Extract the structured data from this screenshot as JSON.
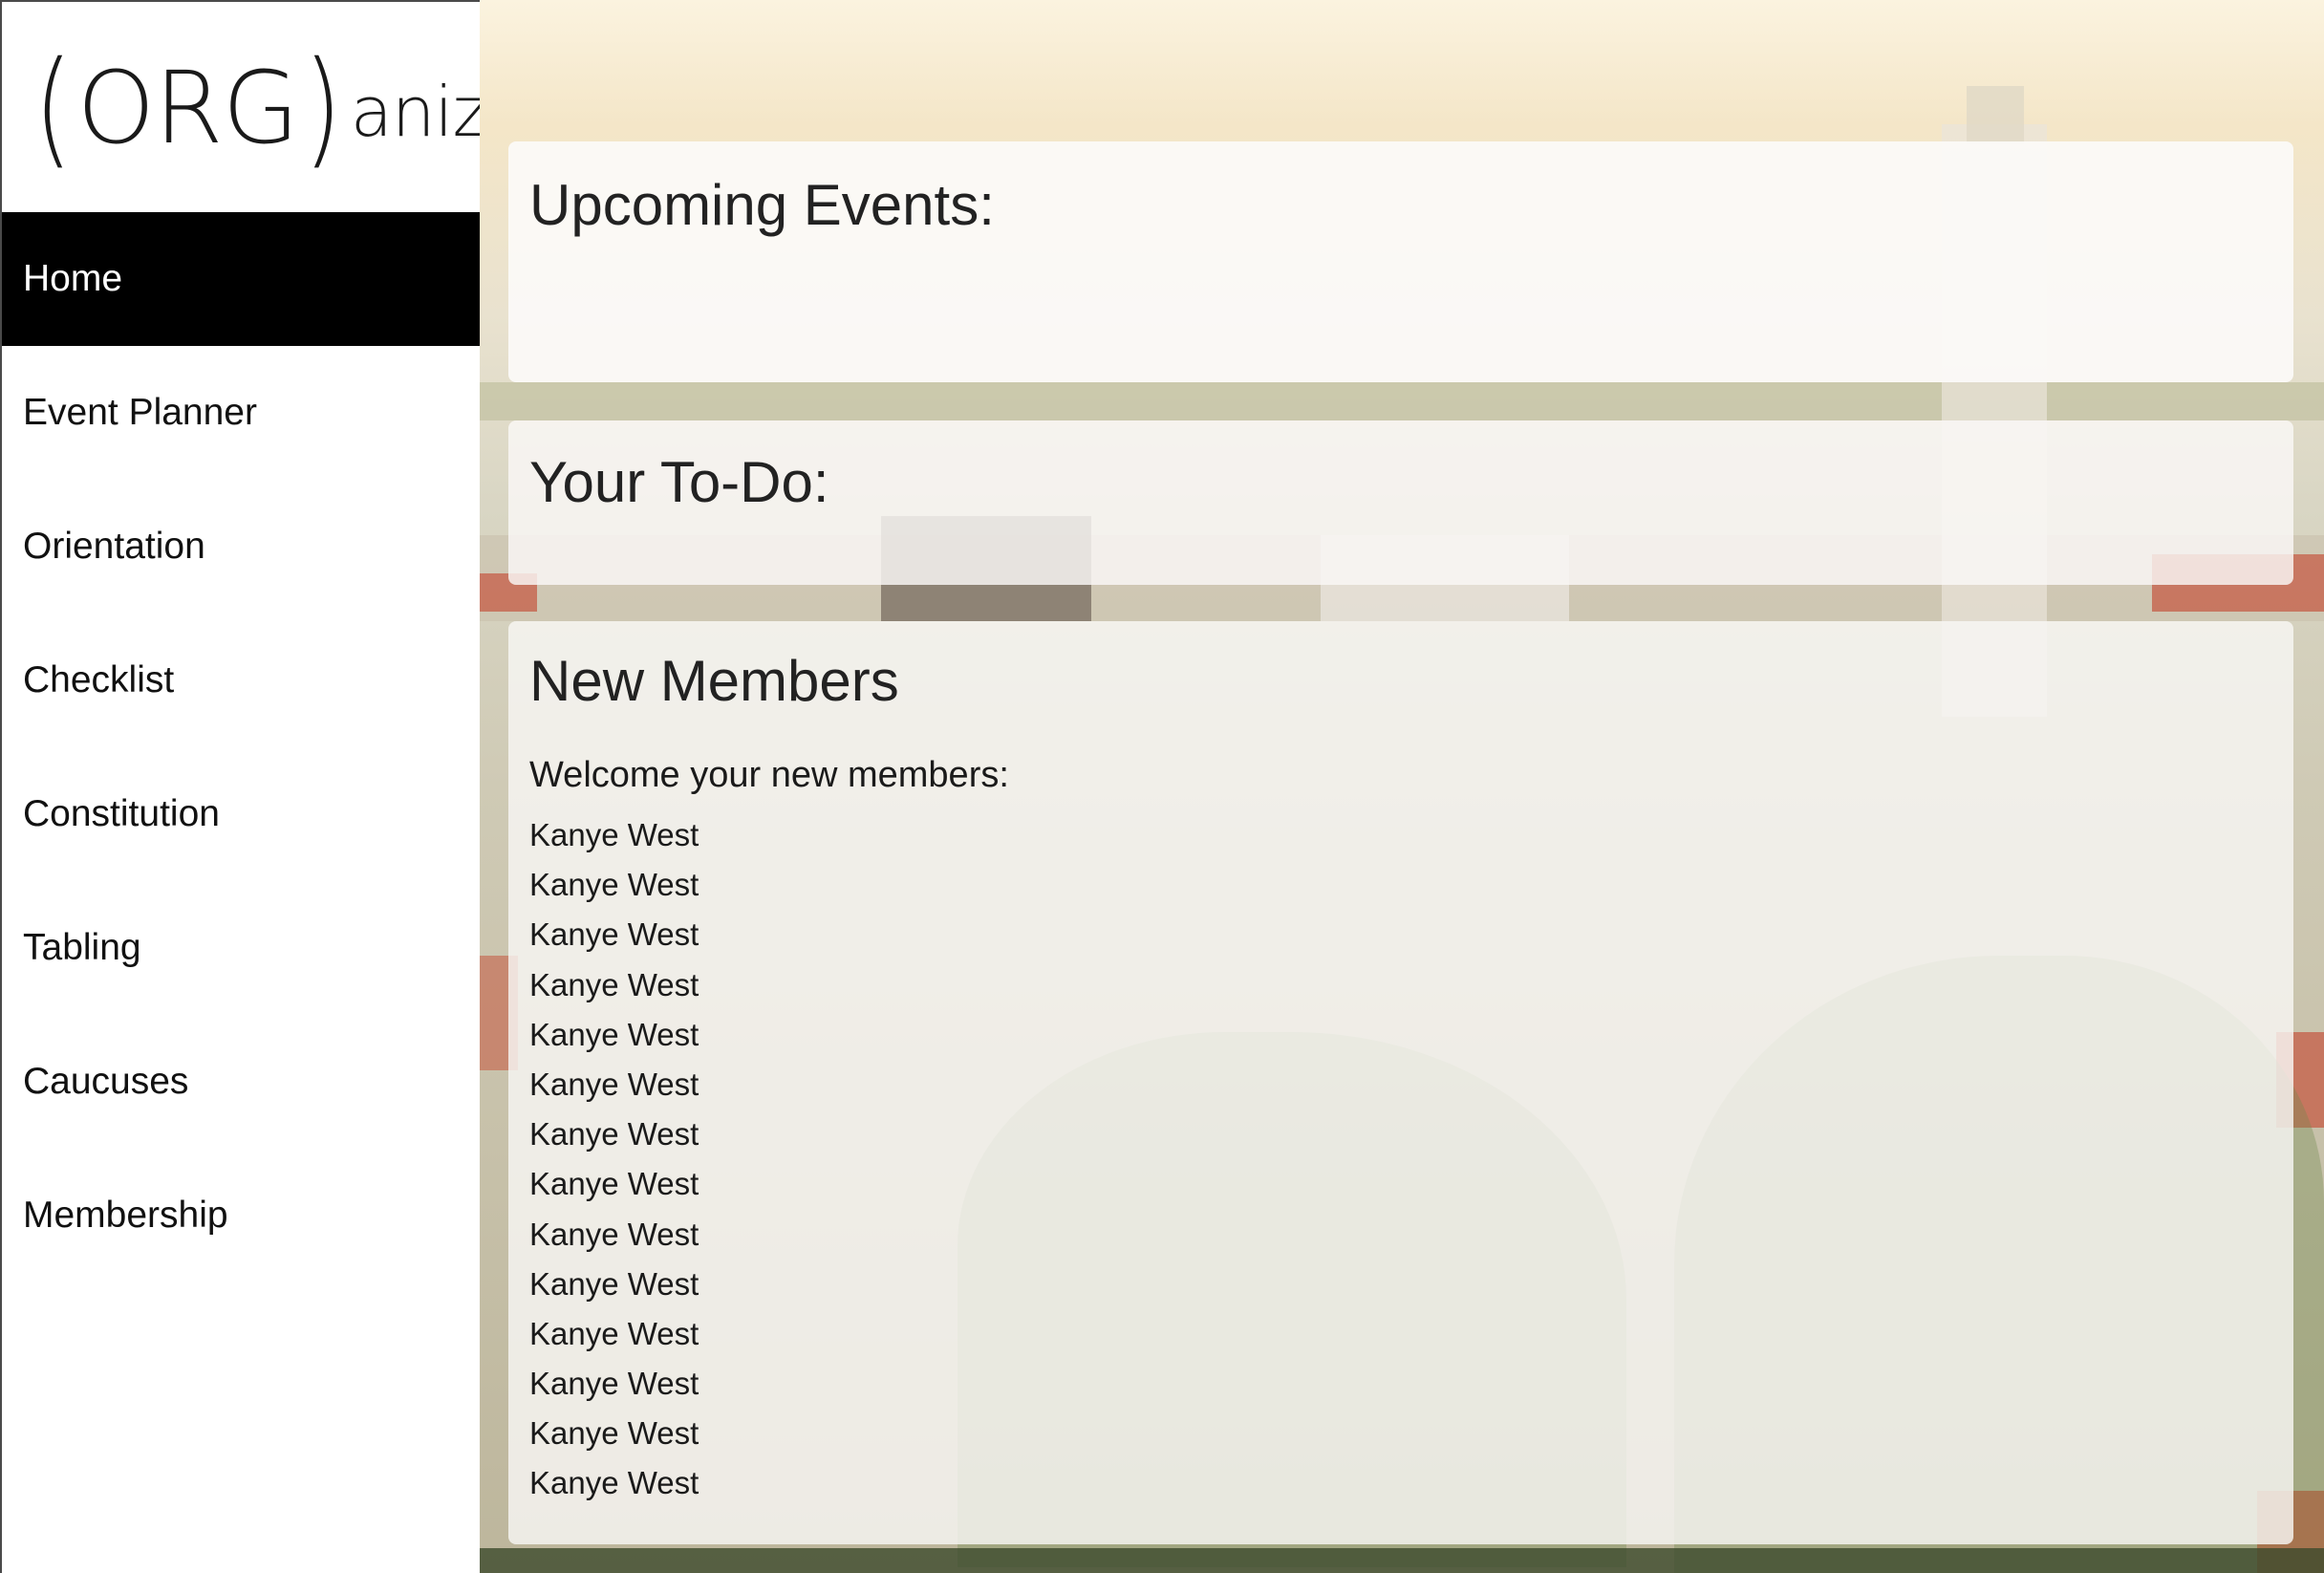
{
  "logo": {
    "open_paren": "(",
    "org": "ORG",
    "close_paren": ")",
    "rest": "anize"
  },
  "nav": {
    "items": [
      {
        "label": "Home",
        "active": true
      },
      {
        "label": "Event Planner",
        "active": false
      },
      {
        "label": "Orientation",
        "active": false
      },
      {
        "label": "Checklist",
        "active": false
      },
      {
        "label": "Constitution",
        "active": false
      },
      {
        "label": "Tabling",
        "active": false
      },
      {
        "label": "Caucuses",
        "active": false
      },
      {
        "label": "Membership",
        "active": false
      }
    ]
  },
  "events_panel": {
    "title": "Upcoming Events:"
  },
  "todo_panel": {
    "title": "Your To-Do:"
  },
  "members_panel": {
    "title": "New Members",
    "welcome": "Welcome your new members:",
    "members": [
      "Kanye West",
      "Kanye West",
      "Kanye West",
      "Kanye West",
      "Kanye West",
      "Kanye West",
      "Kanye West",
      "Kanye West",
      "Kanye West",
      "Kanye West",
      "Kanye West",
      "Kanye West",
      "Kanye West",
      "Kanye West"
    ]
  },
  "colors": {
    "nav_active_bg": "#000000",
    "nav_active_text": "#ffffff",
    "roof_red": "#c4553e",
    "foliage_green": "#6f8a4c",
    "sky": "#fbf3df"
  },
  "background": {
    "icon": "campus-tower-photo"
  }
}
